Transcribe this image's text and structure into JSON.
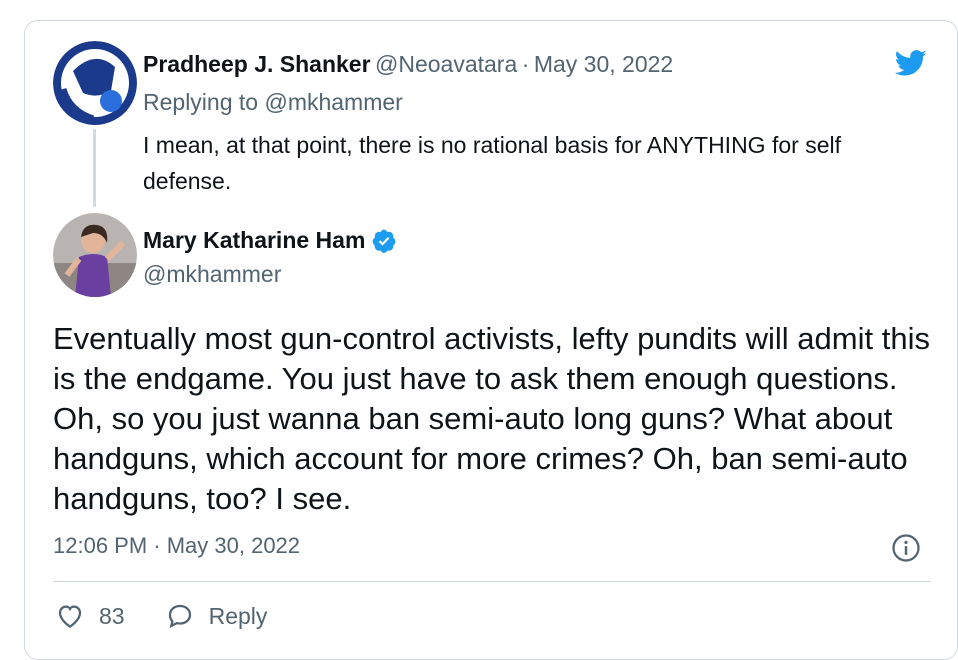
{
  "parent_tweet": {
    "author_name": "Pradheep J. Shanker",
    "author_handle": "@Neoavatara",
    "separator": "·",
    "date": "May 30, 2022",
    "replying_to_label": "Replying to",
    "replying_to_handle": "@mkhammer",
    "text": "I mean, at that point, there is no rational basis for ANYTHING for self defense."
  },
  "main_tweet": {
    "author_name": "Mary Katharine Ham",
    "author_handle": "@mkhammer",
    "verified": true,
    "text": "Eventually most gun-control activists, lefty pundits will admit this is the endgame. You just have to ask them enough questions. Oh, so you just wanna ban semi-auto long guns? What about handguns, which account for more crimes? Oh, ban semi-auto handguns, too? I see.",
    "timestamp": "12:06 PM · May 30, 2022"
  },
  "actions": {
    "like_count": "83",
    "reply_label": "Reply"
  },
  "icons": {
    "brand": "twitter-bird-icon",
    "verified": "verified-badge-icon",
    "info": "info-icon",
    "like": "heart-icon",
    "reply": "reply-bubble-icon"
  },
  "colors": {
    "twitter_blue": "#1d9bf0",
    "text_primary": "#0f1419",
    "text_secondary": "#536471",
    "border": "#cfd9de"
  }
}
